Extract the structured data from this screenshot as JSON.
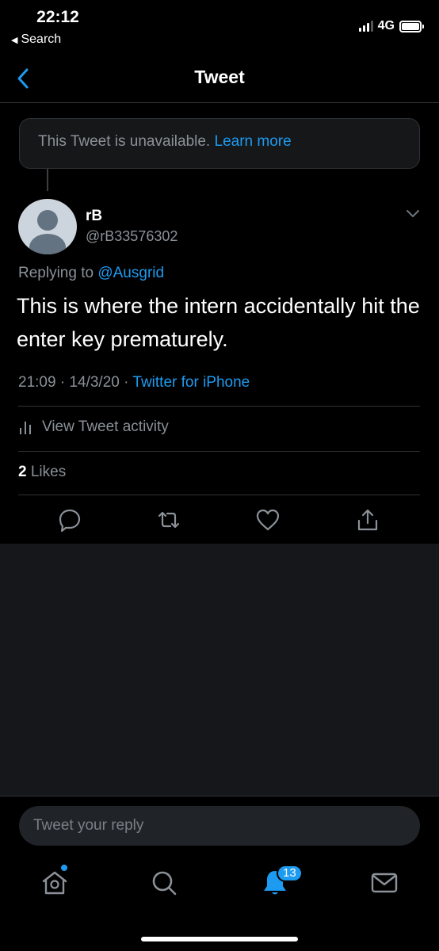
{
  "status_bar": {
    "time": "22:12",
    "back_label": "Search",
    "network": "4G"
  },
  "nav": {
    "title": "Tweet"
  },
  "unavailable": {
    "text": "This Tweet is unavailable.",
    "link": "Learn more"
  },
  "tweet": {
    "display_name": "rB",
    "handle": "@rB33576302",
    "replying_prefix": "Replying to",
    "replying_to": "@Ausgrid",
    "text": "This is where the intern accidentally hit the enter key prematurely.",
    "time": "21:09",
    "date": "14/3/20",
    "client": "Twitter for iPhone",
    "activity_label": "View Tweet activity",
    "likes_count": "2",
    "likes_label": "Likes"
  },
  "reply": {
    "placeholder": "Tweet your reply"
  },
  "tabs": {
    "notifications_badge": "13"
  },
  "colors": {
    "accent": "#1d9bf0",
    "background": "#000000",
    "muted": "#8b9198"
  }
}
